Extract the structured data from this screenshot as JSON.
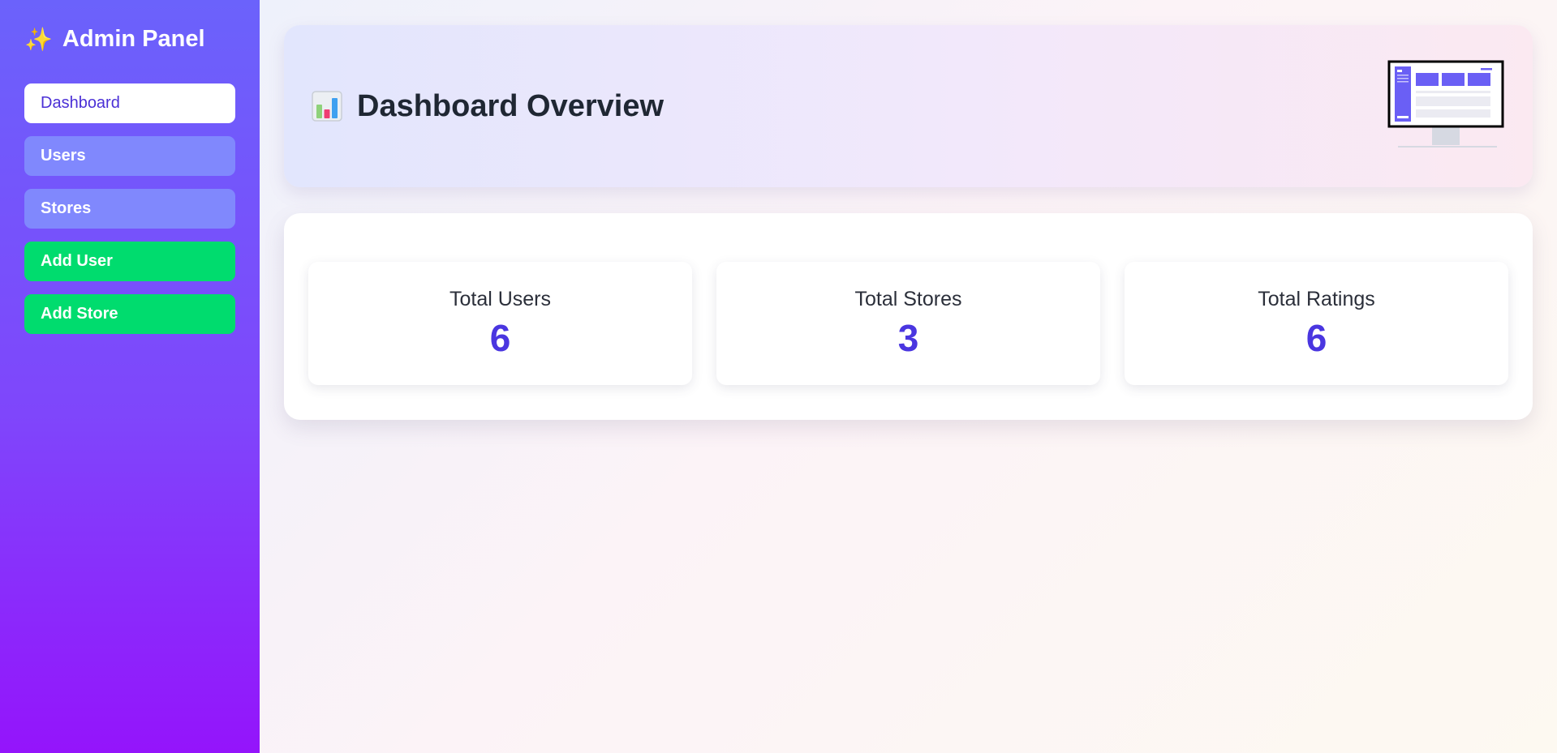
{
  "sidebar": {
    "brand": {
      "icon": "sparkles-icon",
      "title": "Admin Panel"
    },
    "items": [
      {
        "label": "Dashboard",
        "state": "active"
      },
      {
        "label": "Users",
        "state": "default"
      },
      {
        "label": "Stores",
        "state": "default"
      },
      {
        "label": "Add User",
        "state": "action"
      },
      {
        "label": "Add Store",
        "state": "action"
      }
    ]
  },
  "header": {
    "icon": "bar-chart-icon",
    "title": "Dashboard Overview",
    "illustration": "desktop-monitor-icon"
  },
  "stats": [
    {
      "label": "Total Users",
      "value": "6"
    },
    {
      "label": "Total Stores",
      "value": "3"
    },
    {
      "label": "Total Ratings",
      "value": "6"
    }
  ],
  "colors": {
    "sidebar_top": "#6b62fb",
    "sidebar_bottom": "#9414fb",
    "active_text": "#4b30d6",
    "nav_muted": "#8088fd",
    "nav_action": "#00dc6e",
    "stat_value": "#4a36e0",
    "title_text": "#1f2733"
  }
}
